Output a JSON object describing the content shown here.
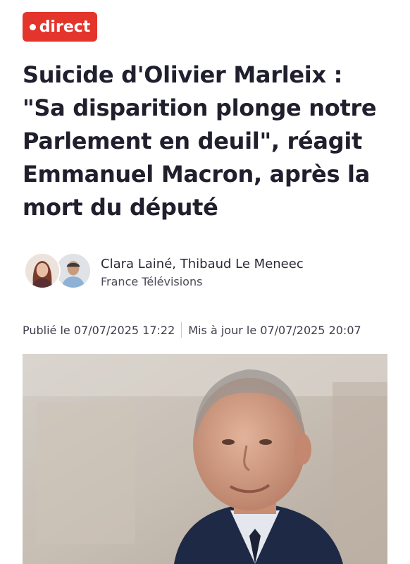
{
  "badge": {
    "label": "direct"
  },
  "article": {
    "headline": "Suicide d'Olivier Marleix : \"Sa disparition plonge notre Parlement en deuil\", réagit Emmanuel Macron, après la mort du député"
  },
  "authors": {
    "names": "Clara Lainé, Thibaud Le Meneec",
    "organization": "France Télévisions"
  },
  "dates": {
    "published": "Publié le 07/07/2025 17:22",
    "updated": "Mis à jour le 07/07/2025 20:07"
  },
  "colors": {
    "badge": "#e4352d",
    "headline": "#1f1f2d"
  }
}
